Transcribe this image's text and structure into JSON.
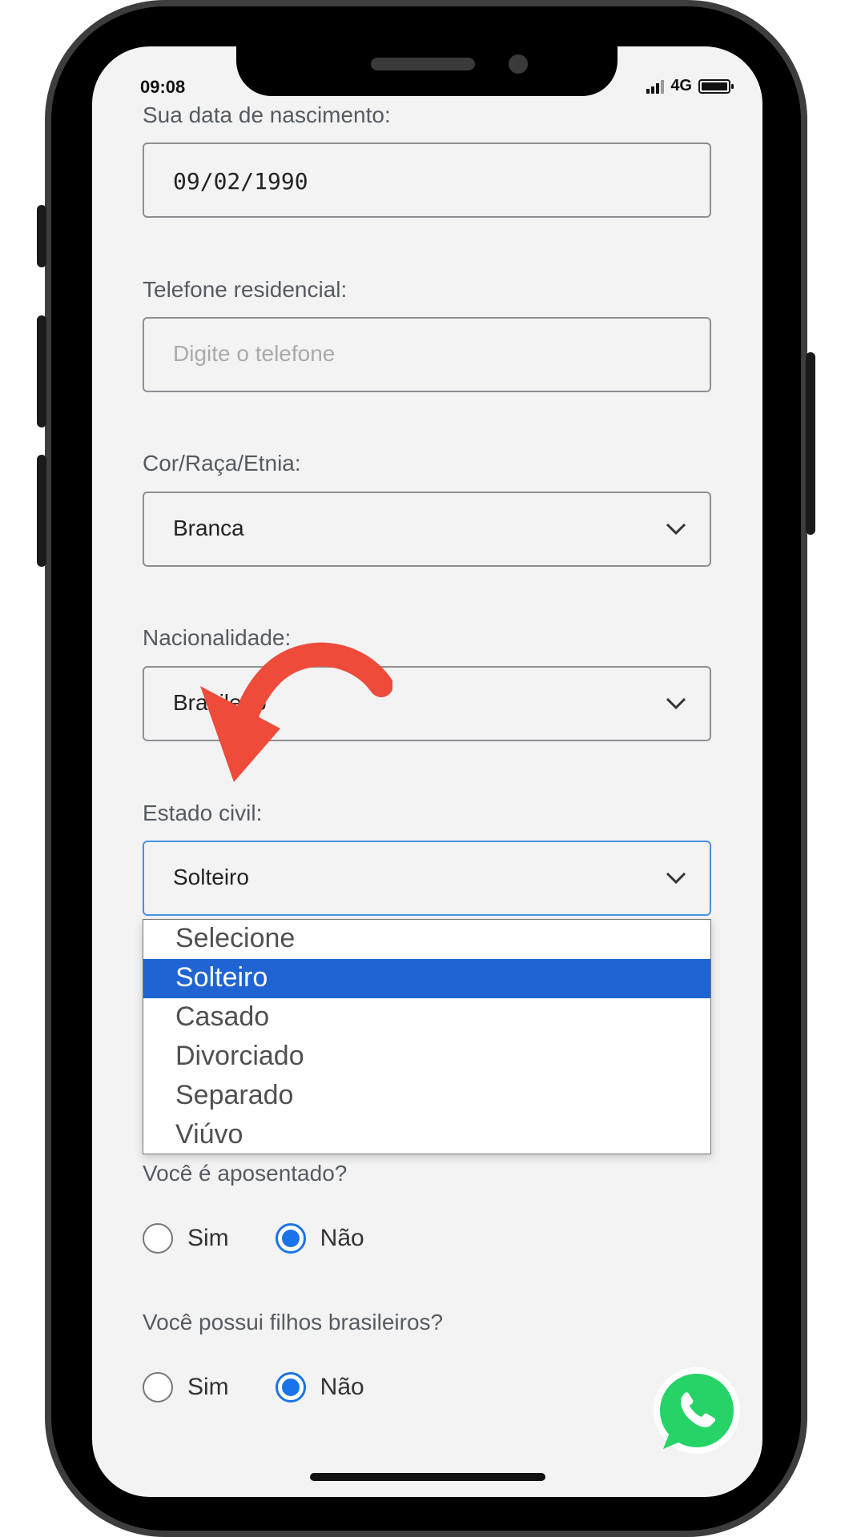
{
  "status_bar": {
    "time": "09:08",
    "network": "4G"
  },
  "form": {
    "birth_label": "Sua data de nascimento:",
    "birth_value": "09/02/1990",
    "phone_label": "Telefone residencial:",
    "phone_placeholder": "Digite o telefone",
    "race_label": "Cor/Raça/Etnia:",
    "race_value": "Branca",
    "nationality_label": "Nacionalidade:",
    "nationality_value": "Brasileiro",
    "civil_label": "Estado civil:",
    "civil_value": "Solteiro",
    "civil_options": [
      "Selecione",
      "Solteiro",
      "Casado",
      "Divorciado",
      "Separado",
      "Viúvo"
    ],
    "civil_selected_index": 1,
    "retired_label": "Você é aposentado?",
    "retired_yes": "Sim",
    "retired_no": "Não",
    "retired_selected": "Não",
    "children_label": "Você possui filhos brasileiros?",
    "children_yes": "Sim",
    "children_no": "Não",
    "children_selected": "Não"
  },
  "colors": {
    "accent": "#1f64d2",
    "radio": "#1a73e8",
    "annotation_arrow": "#ee4b3a",
    "whatsapp": "#25d366"
  },
  "icons": [
    "chevron-down-icon",
    "whatsapp-icon",
    "annotation-arrow-icon",
    "signal-icon",
    "battery-icon"
  ]
}
